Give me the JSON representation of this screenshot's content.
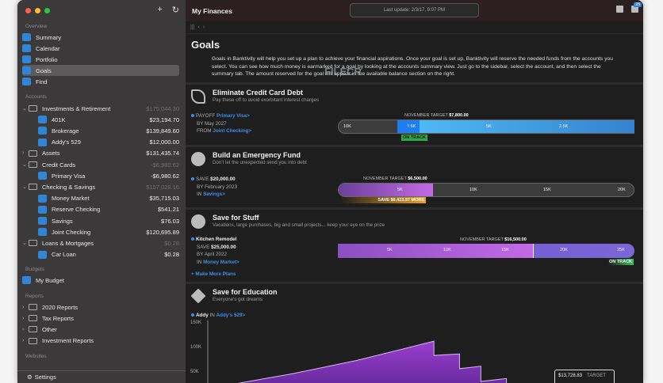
{
  "window": {
    "title": "My Finances",
    "last_update": "Last update: 2/3/17, 9:07 PM",
    "badge": "25"
  },
  "sidebar": {
    "sections": {
      "overview": "Overview",
      "accounts": "Accounts",
      "budgets": "Budgets",
      "reports": "Reports",
      "websites": "Websites"
    },
    "overview": [
      {
        "label": "Summary"
      },
      {
        "label": "Calendar"
      },
      {
        "label": "Portfolio"
      },
      {
        "label": "Goals"
      },
      {
        "label": "Find"
      }
    ],
    "accounts": [
      {
        "label": "Investments & Retirement",
        "amount": "$175,044.30",
        "group": true
      },
      {
        "label": "401K",
        "amount": "$23,194.70"
      },
      {
        "label": "Brokerage",
        "amount": "$139,849.60"
      },
      {
        "label": "Addy's 529",
        "amount": "$12,000.00"
      },
      {
        "label": "Assets",
        "amount": "$131,435.74",
        "group": true
      },
      {
        "label": "Credit Cards",
        "amount": "-$6,980.62",
        "group": true
      },
      {
        "label": "Primary Visa",
        "amount": "-$6,980.62"
      },
      {
        "label": "Checking & Savings",
        "amount": "$157,028.16",
        "group": true
      },
      {
        "label": "Money Market",
        "amount": "$35,715.03"
      },
      {
        "label": "Reserve Checking",
        "amount": "$541.21"
      },
      {
        "label": "Savings",
        "amount": "$76.03"
      },
      {
        "label": "Joint Checking",
        "amount": "$120,695.89"
      },
      {
        "label": "Loans & Mortgages",
        "amount": "$0.28",
        "group": true
      },
      {
        "label": "Car Loan",
        "amount": "$0.28"
      }
    ],
    "budgets": [
      {
        "label": "My Budget"
      }
    ],
    "reports": [
      {
        "label": "2020 Reports"
      },
      {
        "label": "Tax Reports"
      },
      {
        "label": "Other"
      },
      {
        "label": "Investment Reports"
      }
    ],
    "settings": "Settings"
  },
  "main": {
    "title": "Goals",
    "description": "Goals in Banktivity will help you set up a plan to achieve your financial aspirations. Once your goal is set up, Banktivity will reserve the needed funds from the accounts you select. You can see how much money is earmarked for a goal by looking at the accounts summary view. Just go to the sidebar, select the account, and then select the summary tab. The amount reserved for the goal will appear in the available balance section on the right.",
    "goals": [
      {
        "title": "Eliminate Credit Card Debt",
        "subtitle": "Pay these off to avoid exorbitant interest charges",
        "l1a": "PAYOFF",
        "l1b": "Primary Visa>",
        "l2": "BY May 2027",
        "l3a": "FROM",
        "l3b": "Joint Checking>",
        "target_label": "NOVEMBER TARGET",
        "target": "$7,800.00",
        "ticks": [
          "10K",
          "7.6K",
          "5K",
          "2.5K"
        ],
        "status": "ON TRACK"
      },
      {
        "title": "Build an Emergency Fund",
        "subtitle": "Don't let the unexpected send you into debt",
        "l1a": "SAVE",
        "l1b": "$20,000.00",
        "l2": "BY February 2023",
        "l3a": "IN",
        "l3b": "Savings>",
        "target_label": "NOVEMBER TARGET",
        "target": "$6,500.00",
        "ticks": [
          "5K",
          "10K",
          "15K",
          "20K"
        ],
        "status": "SAVE $6,423.97 MORE",
        "progress": 0.32
      },
      {
        "title": "Save for Stuff",
        "subtitle": "Vacations, large purchases, big and small projects... keep your eye on the prize",
        "name": "Kitchen Remodel",
        "l1a": "SAVE",
        "l1b": "$25,000.00",
        "l2": "BY April 2022",
        "l3a": "IN",
        "l3b": "Money Market>",
        "target_label": "NOVEMBER TARGET",
        "target": "$16,500.00",
        "ticks": [
          "5K",
          "10K",
          "15K",
          "20K",
          "25K"
        ],
        "status": "ON TRACK",
        "progress": 0.66
      },
      {
        "title": "Save for Education",
        "subtitle": "Everyone's got dreams",
        "name": "Addy",
        "l3a": "IN",
        "l3b": "Addy's 529>"
      }
    ],
    "make_more": "+ Make More Plans",
    "tooltip": {
      "value": "$13,728.83",
      "label": "TARGET"
    }
  },
  "colors": {
    "accent": "#3d8ee6",
    "ontrack": "#34c759",
    "purple": "#9b3fd0",
    "orange": "#f0a020"
  },
  "chart_data": {
    "type": "area",
    "title": "Save for Education",
    "ylabel": "",
    "xlabel": "",
    "ylim": [
      0,
      150000
    ],
    "yticks": [
      "150K",
      "100K",
      "50K"
    ],
    "x": [
      0,
      7,
      20,
      35,
      53,
      53,
      59,
      59,
      64,
      64,
      70,
      70
    ],
    "values": [
      25000,
      25000,
      45000,
      72000,
      111000,
      82000,
      85000,
      55000,
      60000,
      29000,
      35000,
      0
    ]
  }
}
